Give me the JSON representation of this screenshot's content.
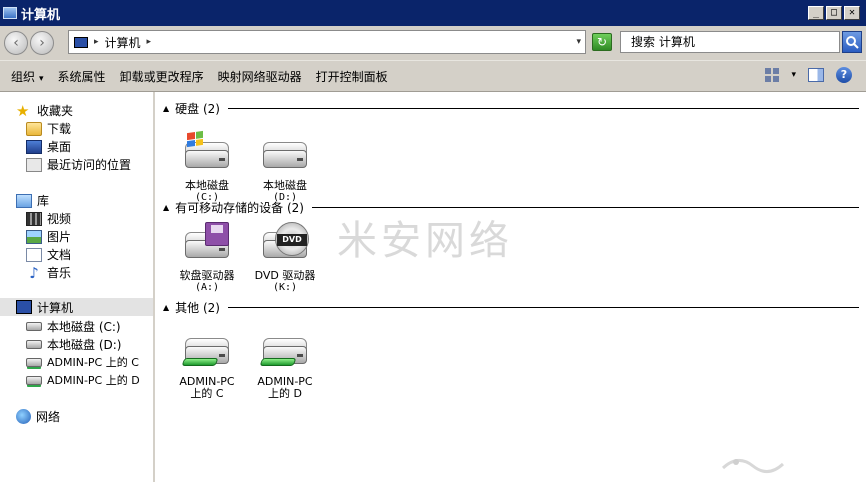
{
  "window": {
    "title": "计算机"
  },
  "address": {
    "crumb": "计算机",
    "sep": "▸",
    "drop": "▾"
  },
  "search": {
    "placeholder": "搜索 计算机"
  },
  "toolbar": {
    "items": [
      "组织",
      "系统属性",
      "卸载或更改程序",
      "映射网络驱动器",
      "打开控制面板"
    ],
    "organize_caret": "▾"
  },
  "nav": {
    "favorites": {
      "label": "收藏夹",
      "items": [
        "下载",
        "桌面",
        "最近访问的位置"
      ]
    },
    "libraries": {
      "label": "库",
      "items": [
        "视频",
        "图片",
        "文档",
        "音乐"
      ]
    },
    "computer": {
      "label": "计算机",
      "items": [
        "本地磁盘 (C:)",
        "本地磁盘 (D:)",
        "ADMIN-PC 上的 C",
        "ADMIN-PC 上的 D"
      ]
    },
    "network": {
      "label": "网络"
    }
  },
  "groups": [
    {
      "header": "硬盘 (2)",
      "tiles": [
        {
          "name": "本地磁盘",
          "sub": "(C:)",
          "kind": "system-disk"
        },
        {
          "name": "本地磁盘",
          "sub": "(D:)",
          "kind": "disk"
        }
      ]
    },
    {
      "header": "有可移动存储的设备 (2)",
      "tiles": [
        {
          "name": "软盘驱动器",
          "sub": "(A:)",
          "kind": "floppy"
        },
        {
          "name": "DVD 驱动器",
          "sub": "(K:)",
          "kind": "dvd"
        }
      ]
    },
    {
      "header": "其他 (2)",
      "tiles": [
        {
          "name": "ADMIN-PC",
          "sub": "上的 C",
          "kind": "network-disk"
        },
        {
          "name": "ADMIN-PC",
          "sub": "上的 D",
          "kind": "network-disk"
        }
      ]
    }
  ],
  "watermark": "米安网络",
  "dvd_label": "DVD",
  "colors": {
    "titlebar": "#0a246a",
    "chrome": "#d4d0c8",
    "selected_row": "#e3e3e3"
  }
}
